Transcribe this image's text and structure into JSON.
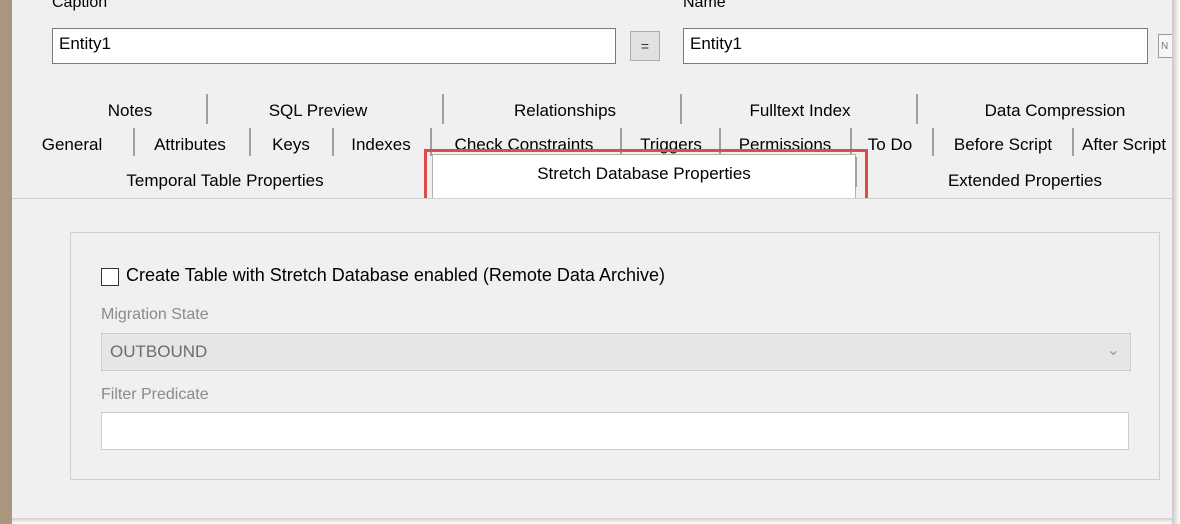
{
  "header": {
    "caption_label": "Caption",
    "caption_value": "Entity1",
    "equals_label": "=",
    "name_label": "Name",
    "name_value": "Entity1",
    "extra_icon_text": "N"
  },
  "tabs": {
    "row1": [
      "Notes",
      "SQL Preview",
      "Relationships",
      "Fulltext Index",
      "Data Compression"
    ],
    "row2": [
      "General",
      "Attributes",
      "Keys",
      "Indexes",
      "Check Constraints",
      "Triggers",
      "Permissions",
      "To Do",
      "Before Script",
      "After Script"
    ],
    "row3": [
      "Temporal Table Properties",
      "Stretch Database Properties",
      "Extended Properties"
    ],
    "active": "Stretch Database Properties"
  },
  "stretch": {
    "enable_label": "Create Table with Stretch Database enabled (Remote Data Archive)",
    "enable_checked": false,
    "migration_label": "Migration State",
    "migration_value": "OUTBOUND",
    "filter_label": "Filter Predicate",
    "filter_value": ""
  },
  "colors": {
    "highlight": "#e04b47",
    "dialog_bg": "#f0f0f0",
    "left_strip": "#a8967f"
  }
}
